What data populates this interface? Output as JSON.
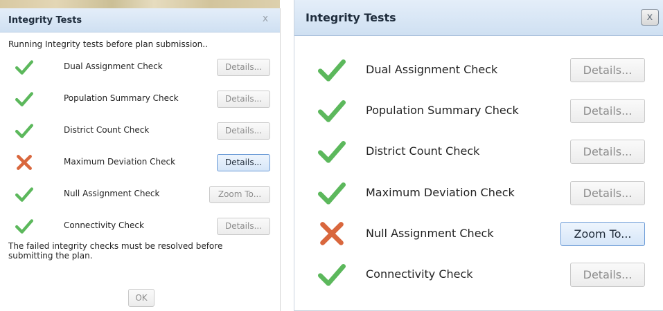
{
  "colors": {
    "check": "#5cb85c",
    "cross": "#d9673d",
    "titlebar": "#d6e4f4"
  },
  "left_dialog": {
    "title": "Integrity Tests",
    "close_label": "x",
    "intro": "Running Integrity tests before plan submission..",
    "checks": [
      {
        "label": "Dual Assignment Check",
        "status": "pass",
        "icon": "check-icon",
        "button": "Details...",
        "button_active": false
      },
      {
        "label": "Population Summary Check",
        "status": "pass",
        "icon": "check-icon",
        "button": "Details...",
        "button_active": false
      },
      {
        "label": "District Count Check",
        "status": "pass",
        "icon": "check-icon",
        "button": "Details...",
        "button_active": false
      },
      {
        "label": "Maximum Deviation Check",
        "status": "fail",
        "icon": "cross-icon",
        "button": "Details...",
        "button_active": true
      },
      {
        "label": "Null Assignment Check",
        "status": "pass",
        "icon": "check-icon",
        "button": "Zoom To...",
        "button_active": false
      },
      {
        "label": "Connectivity Check",
        "status": "pass",
        "icon": "check-icon",
        "button": "Details...",
        "button_active": false
      }
    ],
    "footer": "The failed integrity checks must be resolved before submitting the plan.",
    "ok_label": "OK"
  },
  "right_dialog": {
    "title": "Integrity Tests",
    "close_label": "x",
    "checks": [
      {
        "label": "Dual Assignment Check",
        "status": "pass",
        "icon": "check-icon",
        "button": "Details...",
        "button_active": false
      },
      {
        "label": "Population Summary Check",
        "status": "pass",
        "icon": "check-icon",
        "button": "Details...",
        "button_active": false
      },
      {
        "label": "District Count Check",
        "status": "pass",
        "icon": "check-icon",
        "button": "Details...",
        "button_active": false
      },
      {
        "label": "Maximum Deviation Check",
        "status": "pass",
        "icon": "check-icon",
        "button": "Details...",
        "button_active": false
      },
      {
        "label": "Null Assignment Check",
        "status": "fail",
        "icon": "cross-icon",
        "button": "Zoom To...",
        "button_active": true
      },
      {
        "label": "Connectivity Check",
        "status": "pass",
        "icon": "check-icon",
        "button": "Details...",
        "button_active": false
      }
    ]
  }
}
